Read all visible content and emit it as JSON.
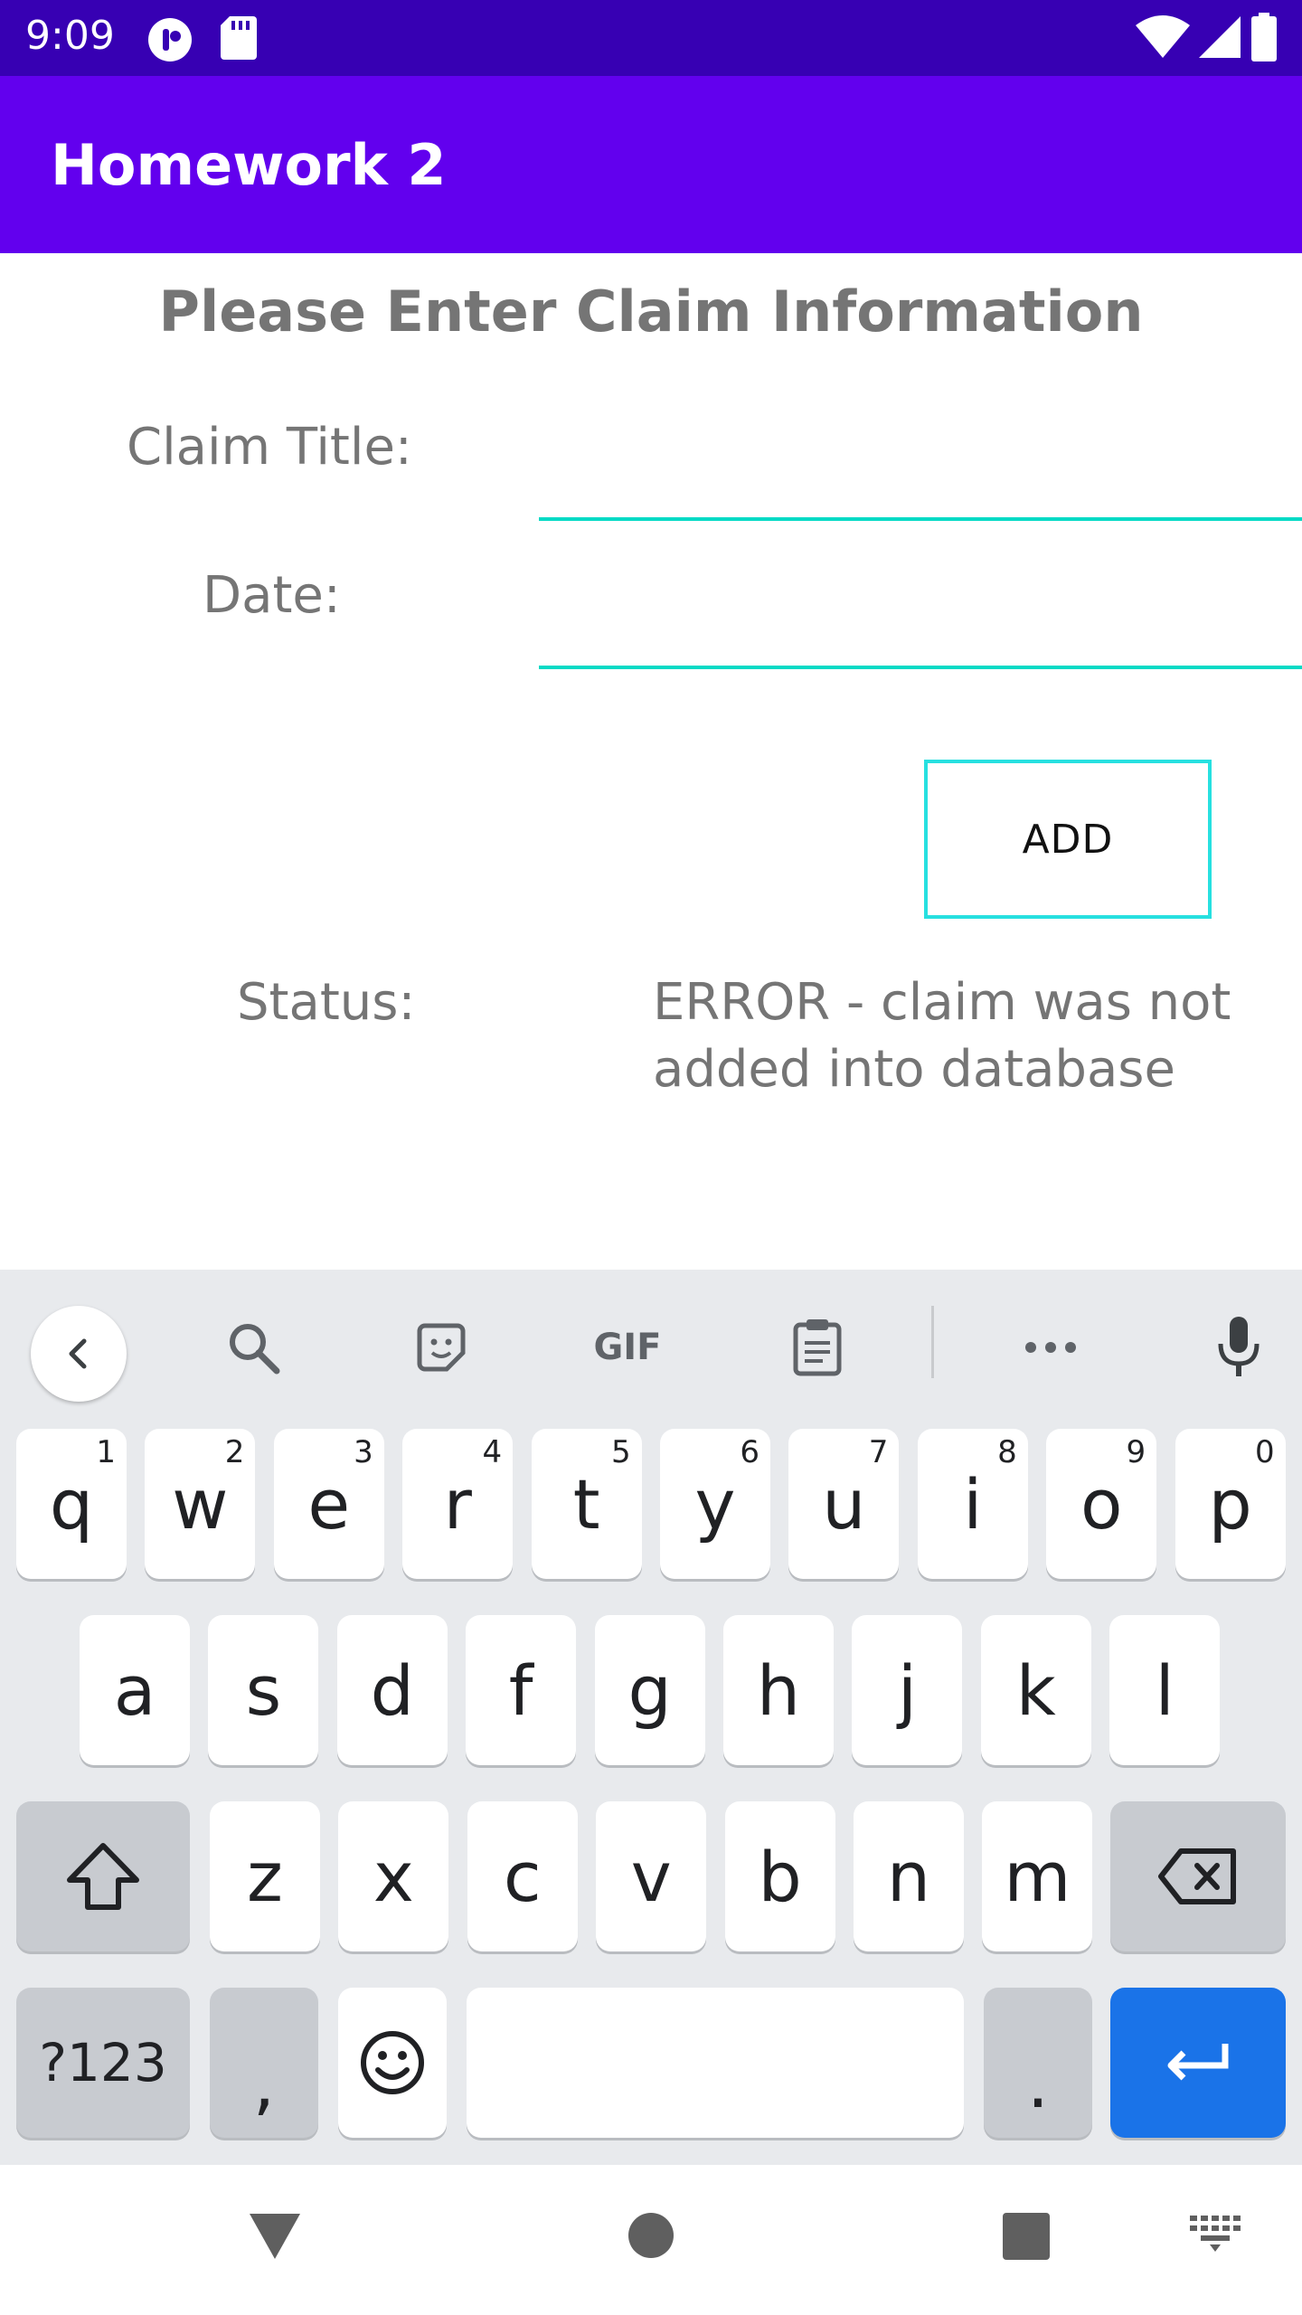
{
  "status_bar": {
    "time": "9:09"
  },
  "app_bar": {
    "title": "Homework 2"
  },
  "form": {
    "heading": "Please Enter Claim Information",
    "claim_title_label": "Claim Title:",
    "claim_title_value": "",
    "date_label": "Date:",
    "date_value": "",
    "add_button": "ADD",
    "status_label": "Status:",
    "status_message": "ERROR - claim was not added into database"
  },
  "keyboard": {
    "toolbar": {
      "gif": "GIF"
    },
    "row1": [
      {
        "k": "q",
        "h": "1"
      },
      {
        "k": "w",
        "h": "2"
      },
      {
        "k": "e",
        "h": "3"
      },
      {
        "k": "r",
        "h": "4"
      },
      {
        "k": "t",
        "h": "5"
      },
      {
        "k": "y",
        "h": "6"
      },
      {
        "k": "u",
        "h": "7"
      },
      {
        "k": "i",
        "h": "8"
      },
      {
        "k": "o",
        "h": "9"
      },
      {
        "k": "p",
        "h": "0"
      }
    ],
    "row2": [
      "a",
      "s",
      "d",
      "f",
      "g",
      "h",
      "j",
      "k",
      "l"
    ],
    "row3": [
      "z",
      "x",
      "c",
      "v",
      "b",
      "n",
      "m"
    ],
    "symbols_key": "?123",
    "comma_key": ",",
    "period_key": "."
  },
  "colors": {
    "status_bar": "#3700b3",
    "app_bar": "#6200ee",
    "accent": "#03dac5",
    "enter_key": "#1a73e8"
  }
}
